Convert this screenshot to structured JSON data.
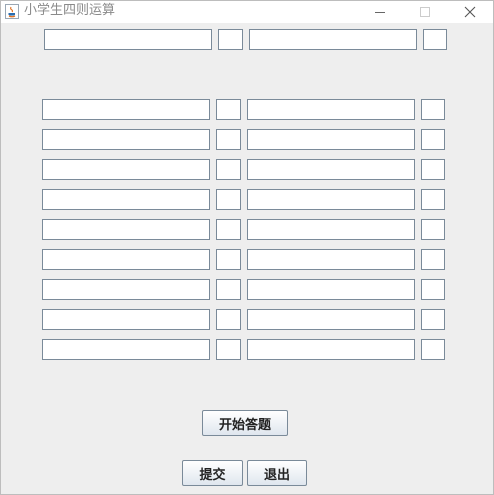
{
  "window": {
    "title": "小学生四则运算",
    "icon": "java-coffee-icon",
    "controls": [
      "minimize-icon",
      "maximize-icon",
      "close-icon"
    ]
  },
  "top_row_fields": [
    "",
    "",
    "",
    ""
  ],
  "question_rows": [
    [
      "",
      "",
      "",
      ""
    ],
    [
      "",
      "",
      "",
      ""
    ],
    [
      "",
      "",
      "",
      ""
    ],
    [
      "",
      "",
      "",
      ""
    ],
    [
      "",
      "",
      "",
      ""
    ],
    [
      "",
      "",
      "",
      ""
    ],
    [
      "",
      "",
      "",
      ""
    ],
    [
      "",
      "",
      "",
      ""
    ],
    [
      "",
      "",
      "",
      ""
    ]
  ],
  "buttons": {
    "start": "开始答题",
    "submit": "提交",
    "exit": "退出"
  }
}
